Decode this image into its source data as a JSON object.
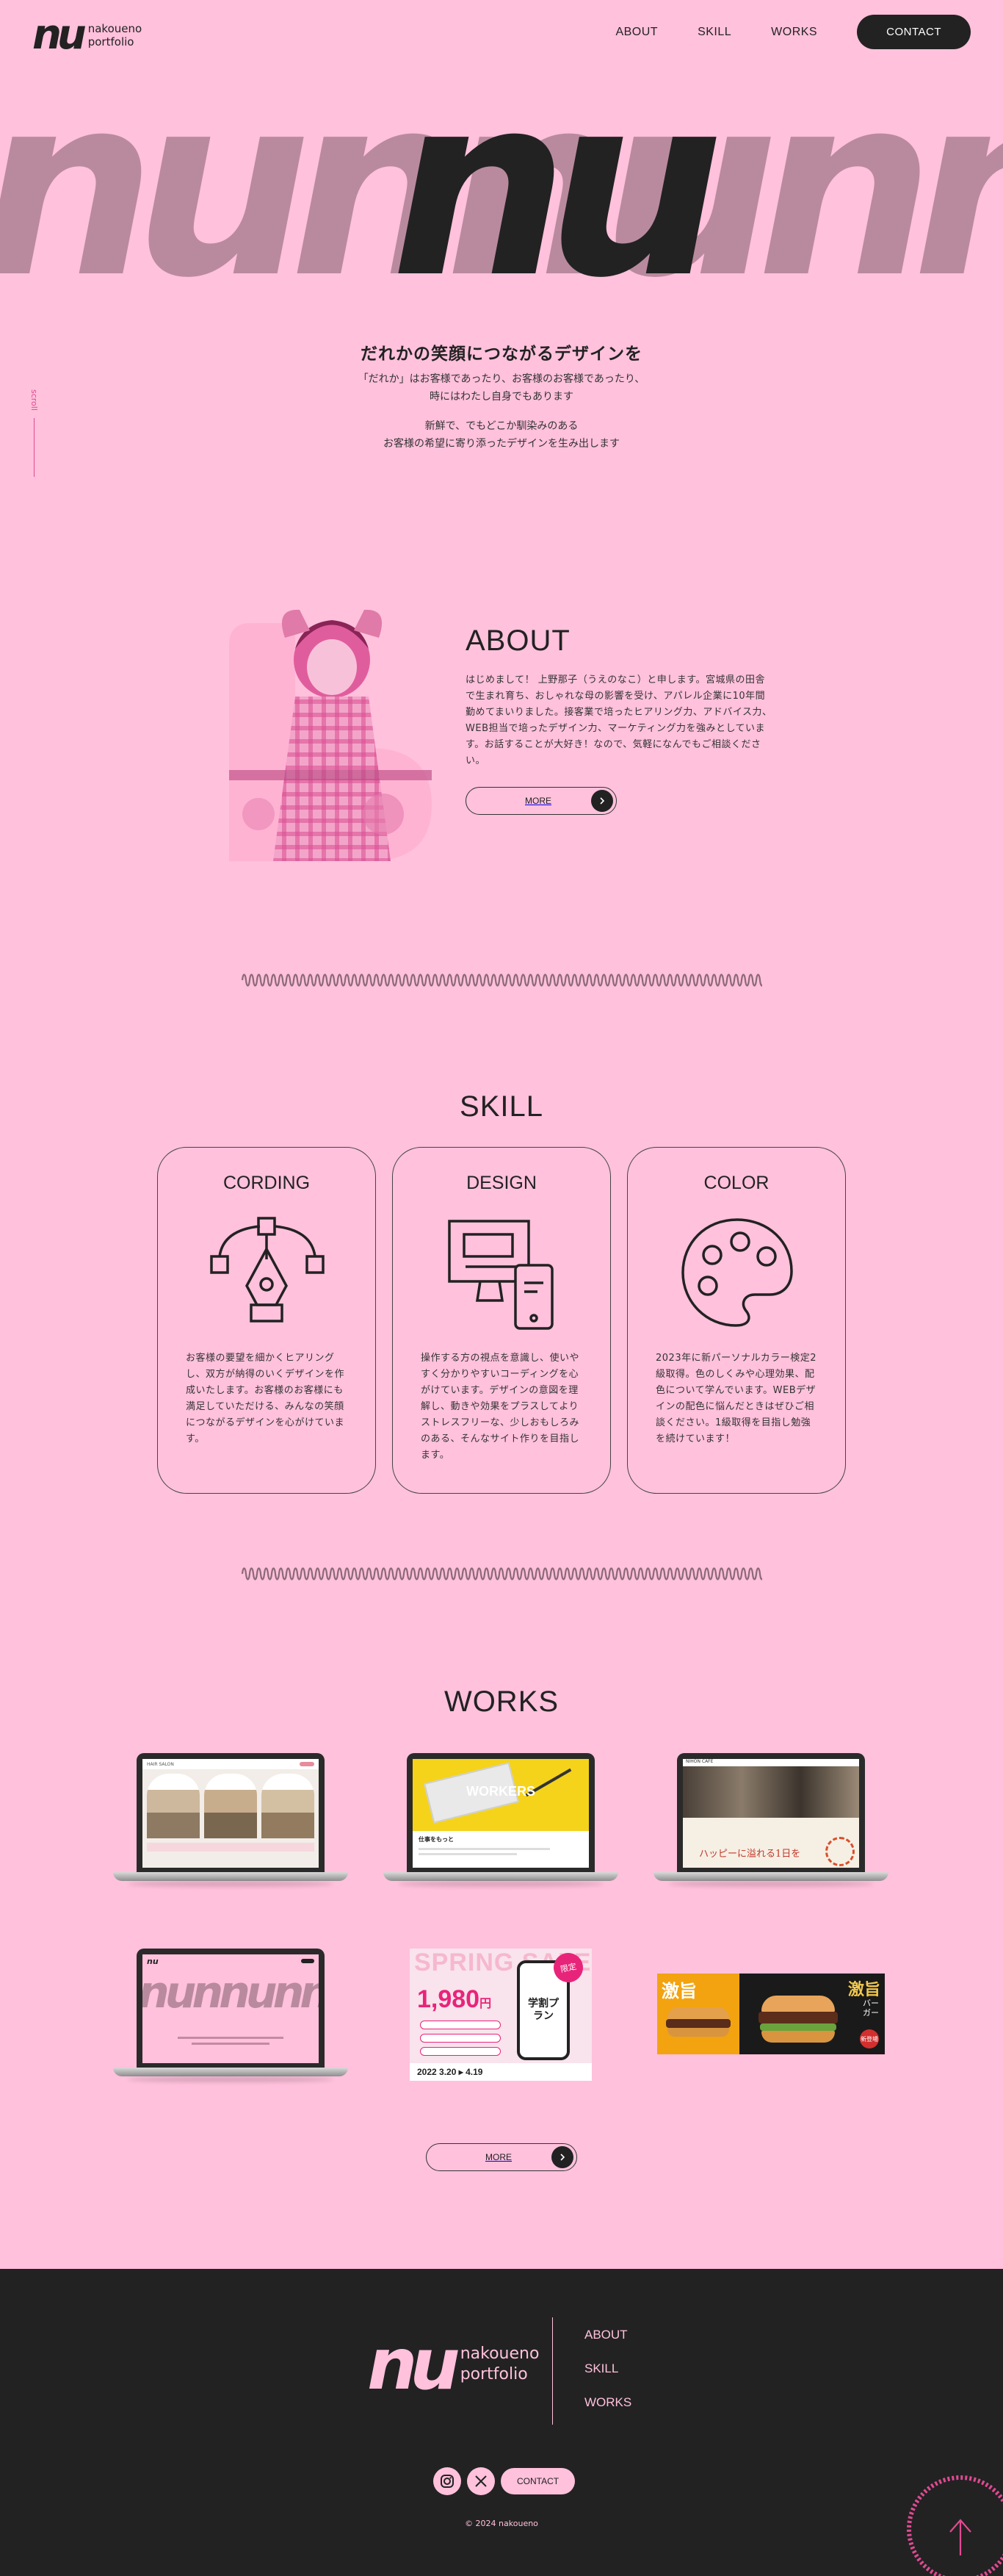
{
  "header": {
    "logo_mark": "nu",
    "logo_line1": "nakoueno",
    "logo_line2": "portfolio",
    "nav": [
      "ABOUT",
      "SKILL",
      "WORKS"
    ],
    "contact": "CONTACT"
  },
  "hero": {
    "letters": "nunnunnu",
    "accent": "nu",
    "heading": "だれかの笑顔につながるデザインを",
    "para1_line1": "「だれか」はお客様であったり、お客様のお客様であったり、",
    "para1_line2": "時にはわたし自身でもあります",
    "para2_line1": "新鮮で、でもどこか馴染みのある",
    "para2_line2": "お客様の希望に寄り添ったデザインを生み出します",
    "scroll": "scroll"
  },
  "about": {
    "title": "ABOUT",
    "text": "はじめまして！ 上野那子（うえのなこ）と申します。宮城県の田舎で生まれ育ち、おしゃれな母の影響を受け、アパレル企業に10年間勤めてまいりました。接客業で培ったヒアリング力、アドバイス力、WEB担当で培ったデザイン力、マーケティング力を強みとしています。お話することが大好き！なので、気軽になんでもご相談ください。",
    "more": "MORE"
  },
  "skill": {
    "title": "SKILL",
    "cards": [
      {
        "title": "CORDING",
        "icon": "pen-tool-icon",
        "text": "お客様の要望を細かくヒアリングし、双方が納得のいくデザインを作成いたします。お客様のお客様にも満足していただける、みんなの笑顔につながるデザインを心がけています。"
      },
      {
        "title": "DESIGN",
        "icon": "devices-icon",
        "text": "操作する方の視点を意識し、使いやすく分かりやすいコーディングを心がけています。デザインの意図を理解し、動きや効果をプラスしてよりストレスフリーな、少しおもしろみのある、そんなサイト作りを目指します。"
      },
      {
        "title": "COLOR",
        "icon": "palette-icon",
        "text": "2023年に新パーソナルカラー検定2級取得。色のしくみや心理効果、配色について学んでいます。WEBデザインの配色に悩んだときはぜひご相談ください。1級取得を目指し勉強を続けています！"
      }
    ]
  },
  "works": {
    "title": "WORKS",
    "w1": {
      "title": "HAIR SALON"
    },
    "w2": {
      "title": "WORKERS",
      "sub": "仕事をもっと"
    },
    "w3": {
      "title": "NIHON CAFE",
      "sub": "ハッピーに溢れる1日を"
    },
    "w4": {
      "title": "nunnunnu"
    },
    "w5": {
      "title": "SPRING SALE",
      "price": "1,980",
      "yen": "円",
      "plan": "学割プラン",
      "dates": "2022 3.20 ▸ 4.19",
      "badge": "限定"
    },
    "w6": {
      "left": "激旨",
      "right_title": "激旨",
      "right_sub": "バーガー",
      "right_tag": "新登場"
    },
    "more": "MORE"
  },
  "footer": {
    "mark": "nu",
    "line1": "nakoueno",
    "line2": "portfolio",
    "nav": [
      "ABOUT",
      "SKILL",
      "WORKS"
    ],
    "contact": "CONTACT",
    "copyright": "© 2024 nakoueno"
  },
  "colors": {
    "bg": "#ffc1dc",
    "dark": "#222222",
    "accent": "#e04a92",
    "hero_letters": "#b98a9e"
  }
}
